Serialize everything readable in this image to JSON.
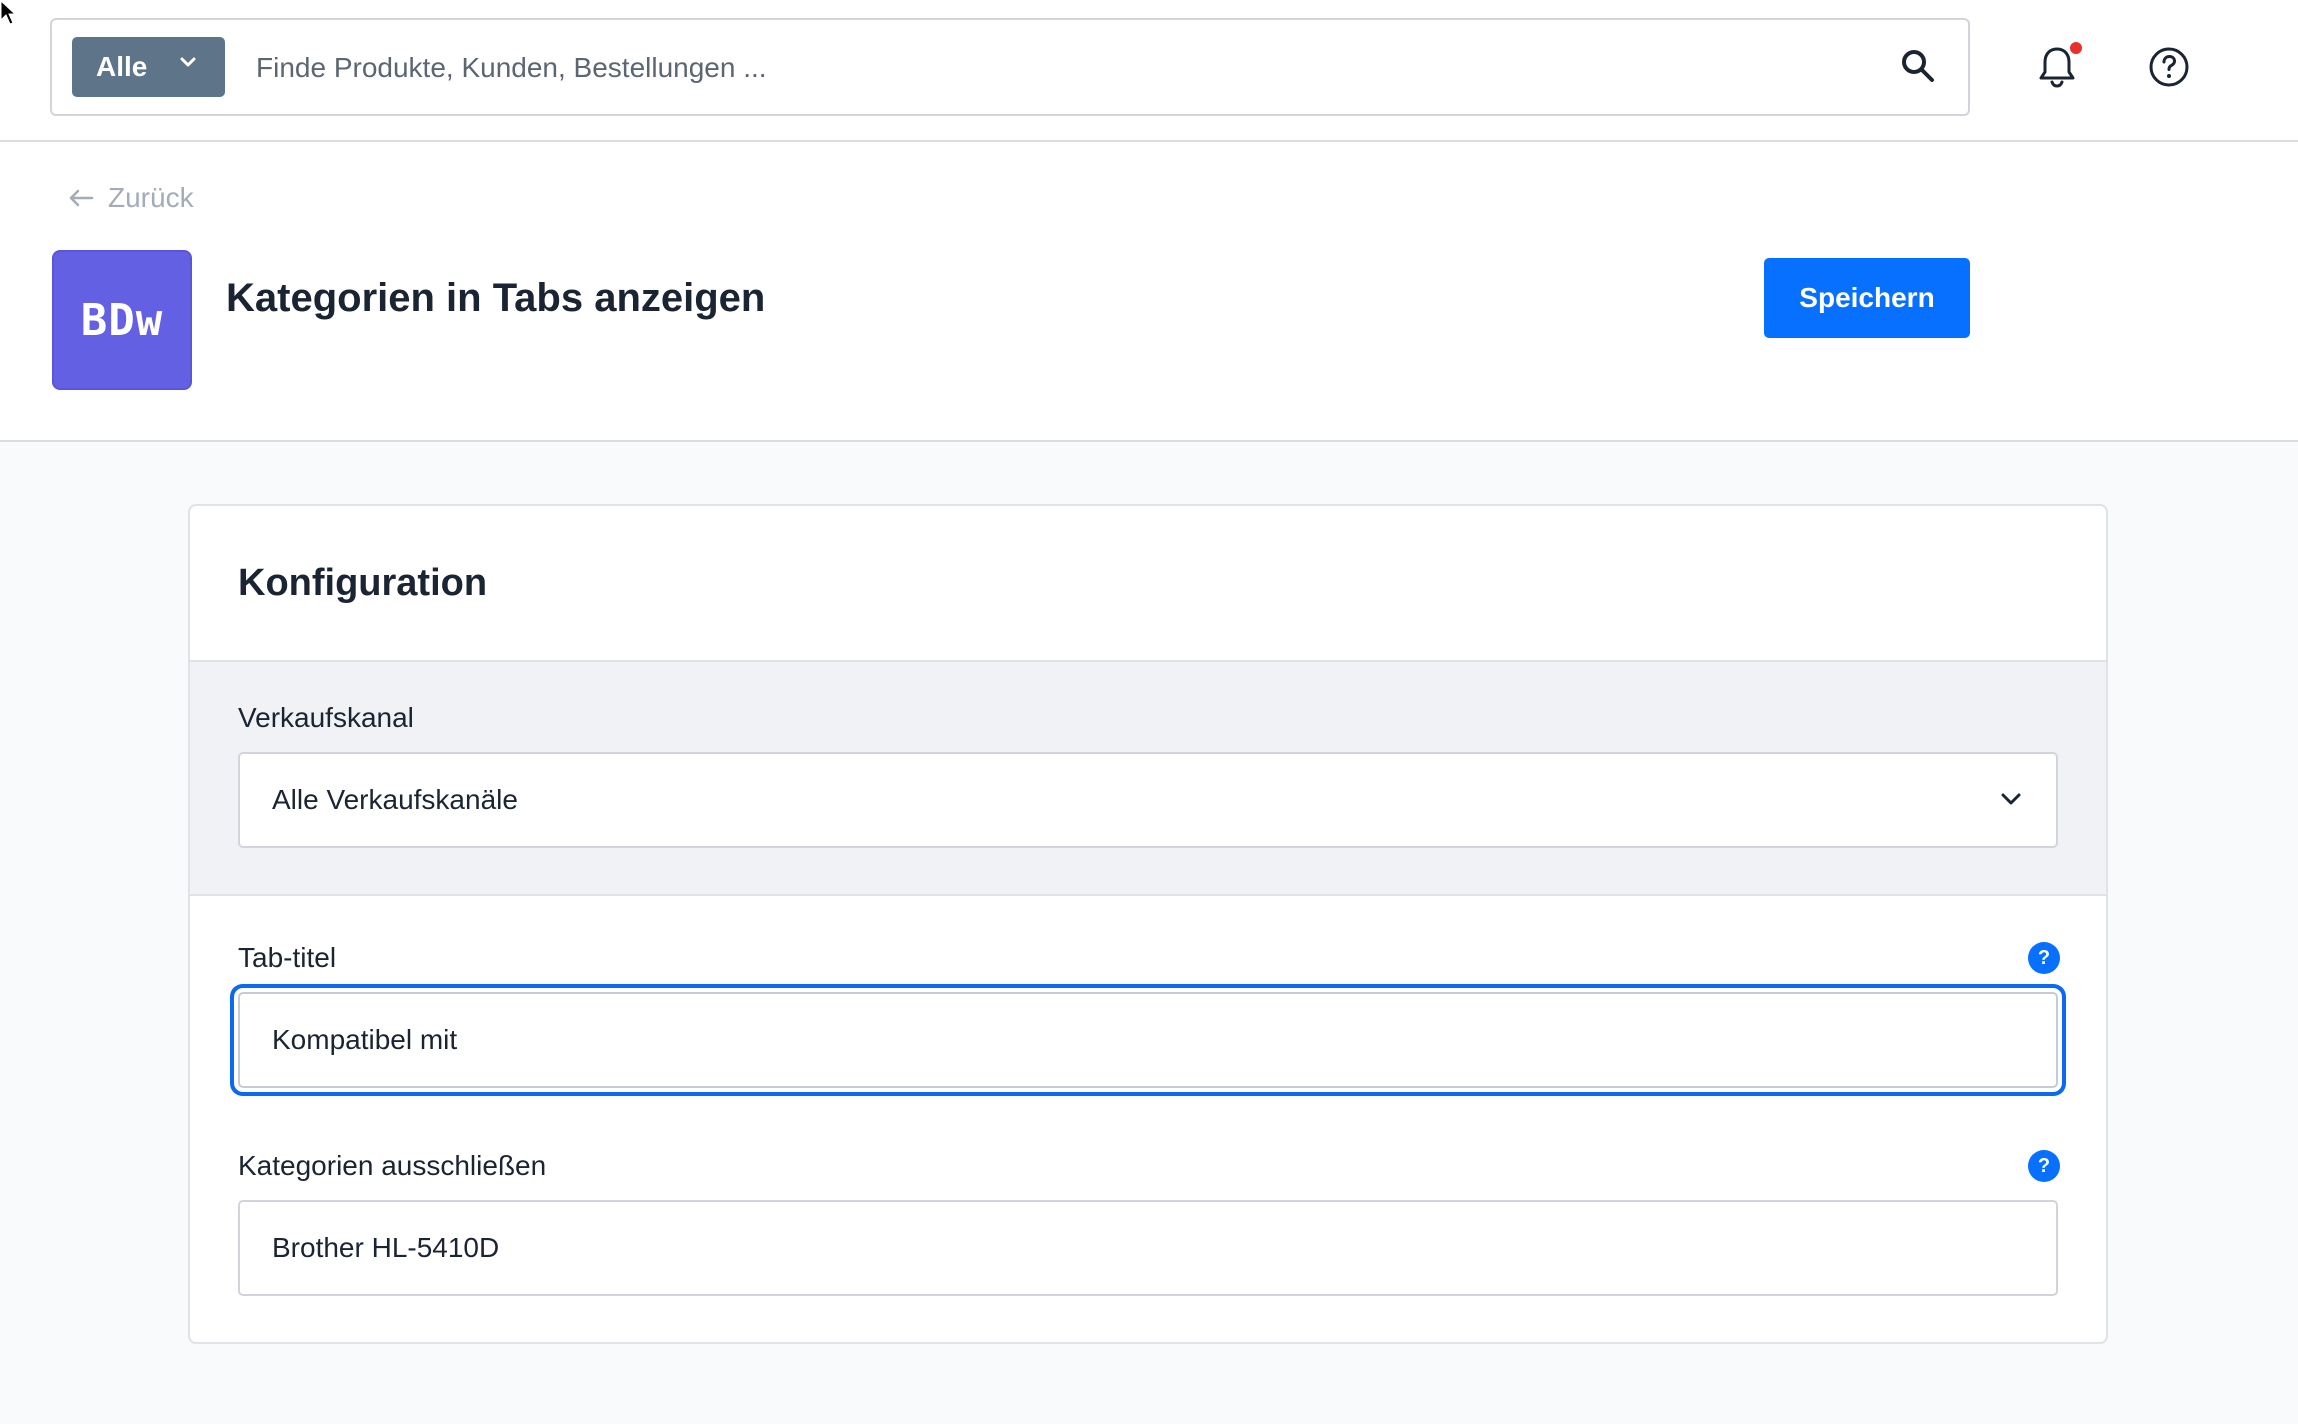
{
  "topbar": {
    "scope_label": "Alle",
    "search_placeholder": "Finde Produkte, Kunden, Bestellungen ...",
    "notification_dot_color": "#e9302a"
  },
  "header": {
    "back_label": "Zurück",
    "app_logo_text": "BDw",
    "title": "Kategorien in Tabs anzeigen",
    "save_label": "Speichern",
    "accent_color": "#0870ff",
    "logo_color": "#6360e4"
  },
  "config": {
    "title": "Konfiguration",
    "sales_channel": {
      "label": "Verkaufskanal",
      "value": "Alle Verkaufskanäle"
    },
    "tab_title": {
      "label": "Tab-titel",
      "value": "Kompatibel mit",
      "help": "?"
    },
    "exclude_categories": {
      "label": "Kategorien ausschließen",
      "value": "Brother HL-5410D",
      "help": "?"
    }
  }
}
